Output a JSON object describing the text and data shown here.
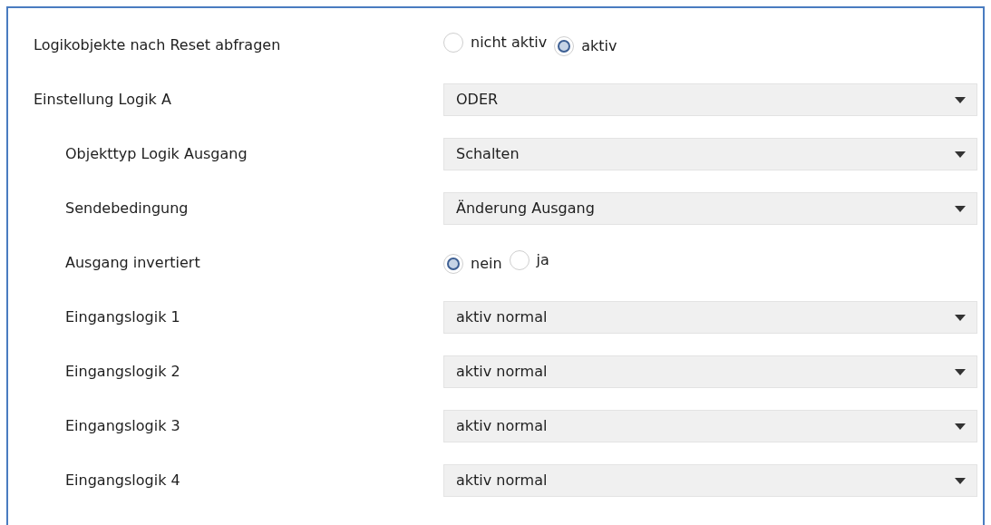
{
  "rows": [
    {
      "label": "Logikobjekte nach Reset abfragen",
      "kind": "radio",
      "options": [
        {
          "label": "nicht aktiv",
          "selected": false
        },
        {
          "label": "aktiv",
          "selected": true
        }
      ]
    },
    {
      "label": "Einstellung Logik A",
      "kind": "select",
      "value": "ODER",
      "children": [
        {
          "label": "Objekttyp Logik Ausgang",
          "kind": "select",
          "value": "Schalten"
        },
        {
          "label": "Sendebedingung",
          "kind": "select",
          "value": "Änderung Ausgang"
        },
        {
          "label": "Ausgang invertiert",
          "kind": "radio",
          "options": [
            {
              "label": "nein",
              "selected": true
            },
            {
              "label": "ja",
              "selected": false
            }
          ]
        },
        {
          "label": "Eingangslogik 1",
          "kind": "select",
          "value": "aktiv normal"
        },
        {
          "label": "Eingangslogik 2",
          "kind": "select",
          "value": "aktiv normal"
        },
        {
          "label": "Eingangslogik 3",
          "kind": "select",
          "value": "aktiv normal"
        },
        {
          "label": "Eingangslogik 4",
          "kind": "select",
          "value": "aktiv normal"
        }
      ]
    }
  ]
}
